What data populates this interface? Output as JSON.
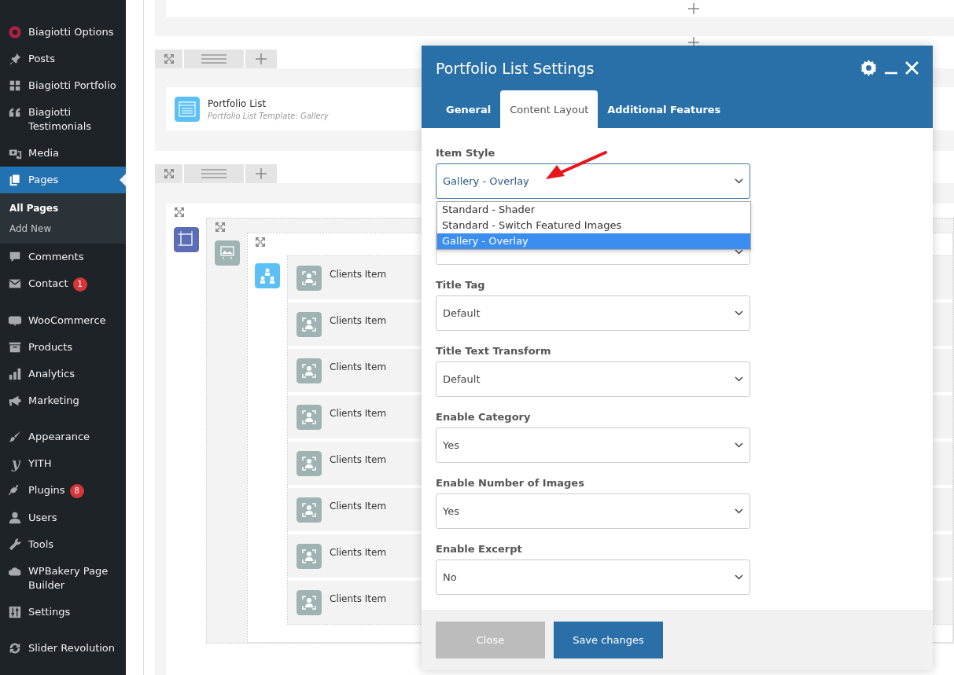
{
  "sidebar": {
    "groups": [
      {
        "items": [
          {
            "label": "Biagiotti Options",
            "selected": false
          },
          {
            "label": "Posts",
            "selected": false
          },
          {
            "label": "Biagiotti Portfolio",
            "selected": false
          },
          {
            "label": "Biagiotti Testimonials",
            "selected": false
          },
          {
            "label": "Media",
            "selected": false
          },
          {
            "label": "Pages",
            "selected": true,
            "children": [
              {
                "label": "All Pages",
                "selected": true
              },
              {
                "label": "Add New",
                "selected": false
              }
            ]
          },
          {
            "label": "Comments",
            "selected": false
          },
          {
            "label": "Contact",
            "selected": false,
            "badge": "1"
          }
        ]
      },
      {
        "items": [
          {
            "label": "WooCommerce",
            "selected": false
          },
          {
            "label": "Products",
            "selected": false
          },
          {
            "label": "Analytics",
            "selected": false
          },
          {
            "label": "Marketing",
            "selected": false
          }
        ]
      },
      {
        "items": [
          {
            "label": "Appearance",
            "selected": false
          },
          {
            "label": "YITH",
            "selected": false,
            "icon_text": "y"
          },
          {
            "label": "Plugins",
            "selected": false,
            "badge": "8"
          },
          {
            "label": "Users",
            "selected": false
          },
          {
            "label": "Tools",
            "selected": false
          },
          {
            "label": "WPBakery Page Builder",
            "selected": false
          },
          {
            "label": "Settings",
            "selected": false
          }
        ]
      },
      {
        "items": [
          {
            "label": "Slider Revolution",
            "selected": false
          }
        ]
      }
    ]
  },
  "editor": {
    "portfolio_element": {
      "title": "Portfolio List",
      "subtitle": "Portfolio List Template: Gallery"
    },
    "client_items": [
      "Clients Item",
      "Clients Item",
      "Clients Item",
      "Clients Item",
      "Clients Item",
      "Clients Item",
      "Clients Item",
      "Clients Item"
    ]
  },
  "modal": {
    "title": "Portfolio List Settings",
    "tabs": [
      {
        "label": "General",
        "selected": false
      },
      {
        "label": "Content Layout",
        "selected": true
      },
      {
        "label": "Additional Features",
        "selected": false
      }
    ],
    "fields": [
      {
        "label": "Item Style",
        "value": "Gallery - Overlay",
        "expanded": true,
        "options": [
          {
            "label": "Standard - Shader",
            "selected": false
          },
          {
            "label": "Standard - Switch Featured Images",
            "selected": false
          },
          {
            "label": "Gallery - Overlay",
            "selected": true
          }
        ]
      },
      {
        "expanded": false
      },
      {
        "label": "Title Tag",
        "value": "Default",
        "expanded": false
      },
      {
        "label": "Title Text Transform",
        "value": "Default",
        "expanded": false
      },
      {
        "label": "Enable Category",
        "value": "Yes",
        "expanded": false
      },
      {
        "label": "Enable Number of Images",
        "value": "Yes",
        "expanded": false
      },
      {
        "label": "Enable Excerpt",
        "value": "No",
        "expanded": false
      }
    ],
    "buttons": [
      {
        "label": "Close",
        "disabled": true
      },
      {
        "label": "Save changes",
        "disabled": false
      }
    ]
  }
}
